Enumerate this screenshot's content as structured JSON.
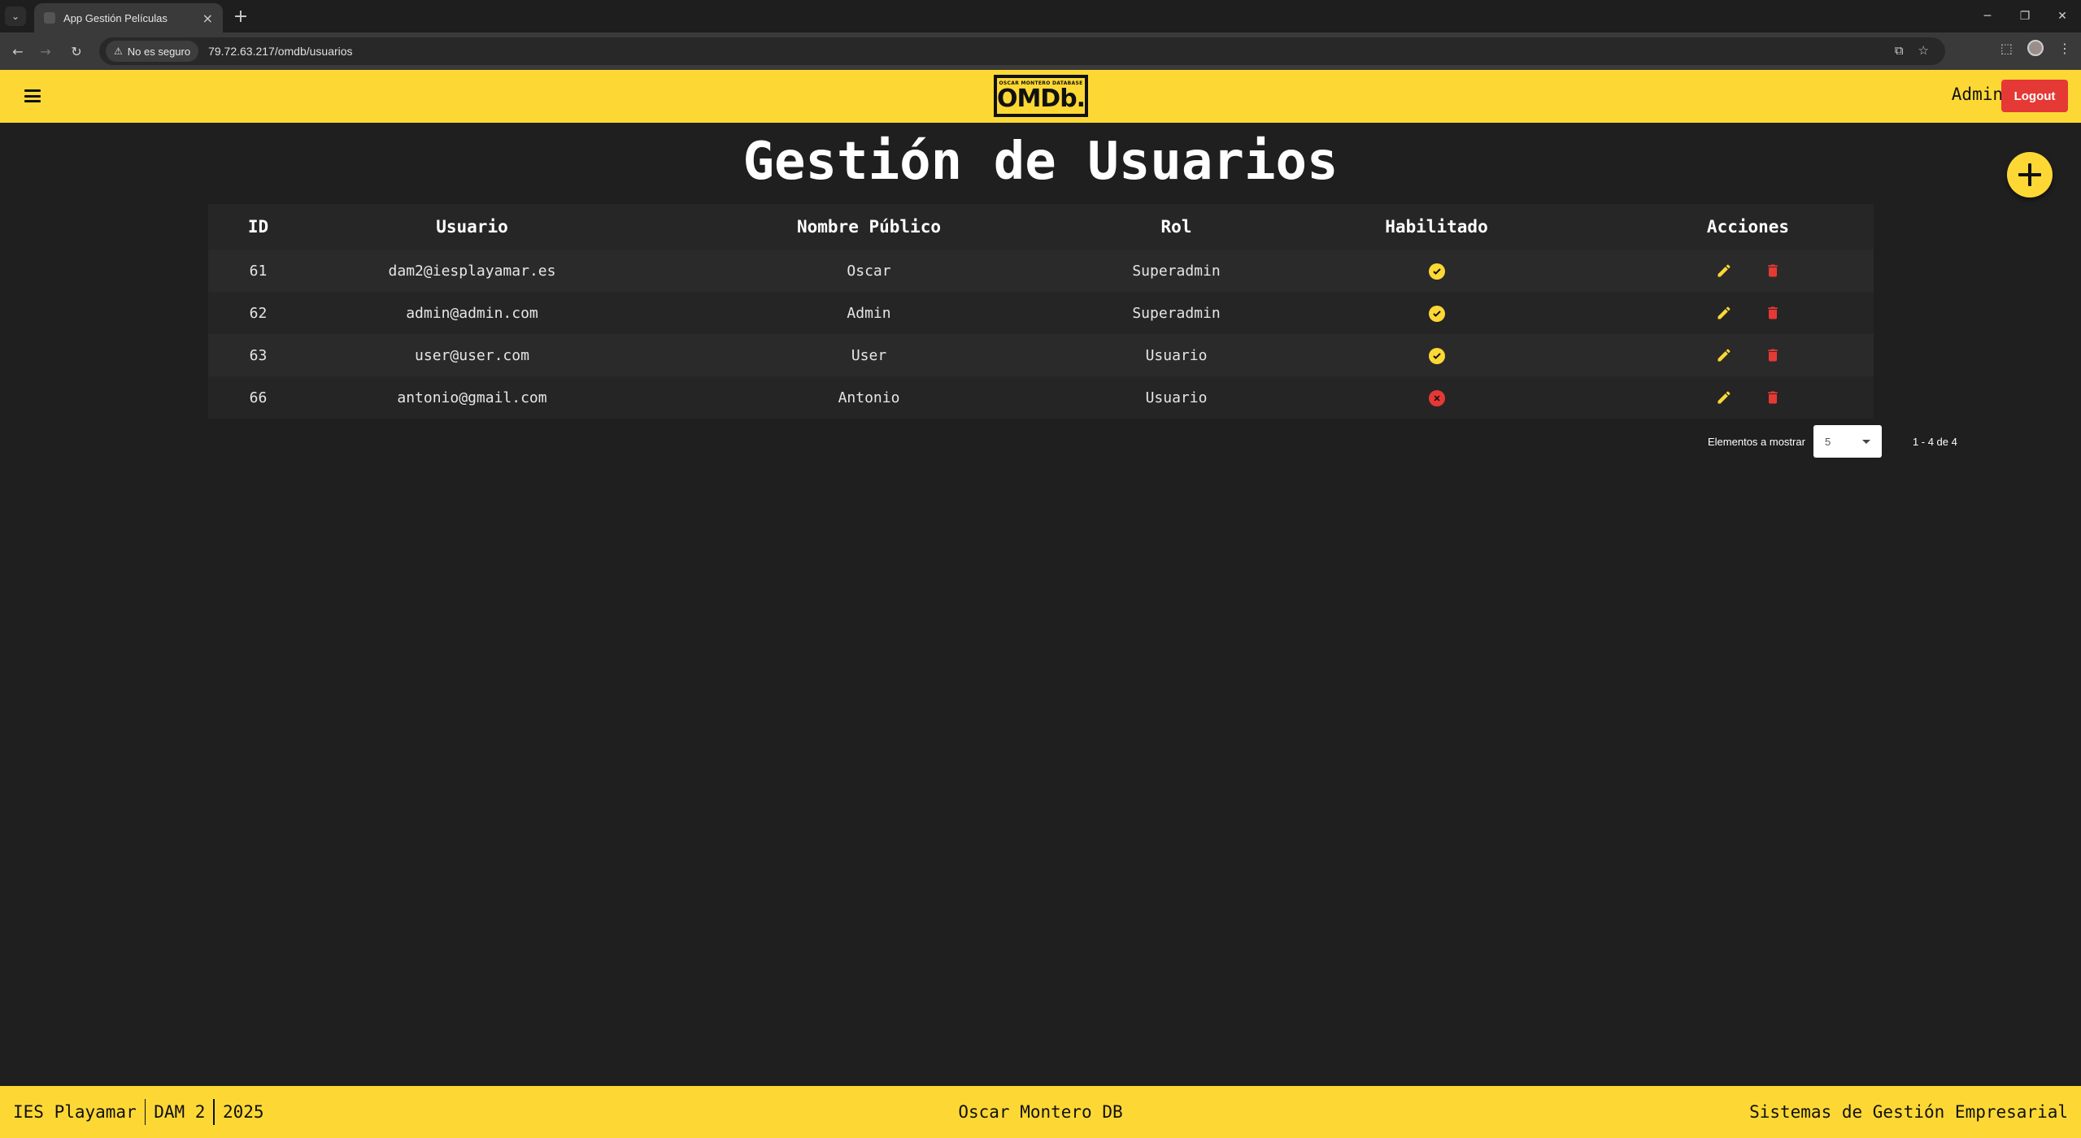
{
  "browser": {
    "tab_title": "App Gestión Películas",
    "security_label": "No es seguro",
    "url": "79.72.63.217/omdb/usuarios"
  },
  "header": {
    "logo_small": "OSCAR MONTERO DATABASE",
    "logo_big": "OMDb.",
    "user": "Admin",
    "logout_label": "Logout"
  },
  "page": {
    "title": "Gestión de Usuarios"
  },
  "table": {
    "columns": [
      "ID",
      "Usuario",
      "Nombre Público",
      "Rol",
      "Habilitado",
      "Acciones"
    ],
    "rows": [
      {
        "id": "61",
        "usuario": "dam2@iesplayamar.es",
        "nombre": "Oscar",
        "rol": "Superadmin",
        "habilitado": true
      },
      {
        "id": "62",
        "usuario": "admin@admin.com",
        "nombre": "Admin",
        "rol": "Superadmin",
        "habilitado": true
      },
      {
        "id": "63",
        "usuario": "user@user.com",
        "nombre": "User",
        "rol": "Usuario",
        "habilitado": true
      },
      {
        "id": "66",
        "usuario": "antonio@gmail.com",
        "nombre": "Antonio",
        "rol": "Usuario",
        "habilitado": false
      }
    ]
  },
  "paginator": {
    "label": "Elementos a mostrar",
    "page_size": "5",
    "range": "1 - 4 de 4"
  },
  "footer": {
    "left": [
      "IES Playamar",
      "DAM 2",
      "2025"
    ],
    "center": "Oscar Montero DB",
    "right": "Sistemas de Gestión Empresarial"
  },
  "colors": {
    "accent": "#fdd835",
    "danger": "#e53935",
    "background": "#1f1f1f"
  }
}
